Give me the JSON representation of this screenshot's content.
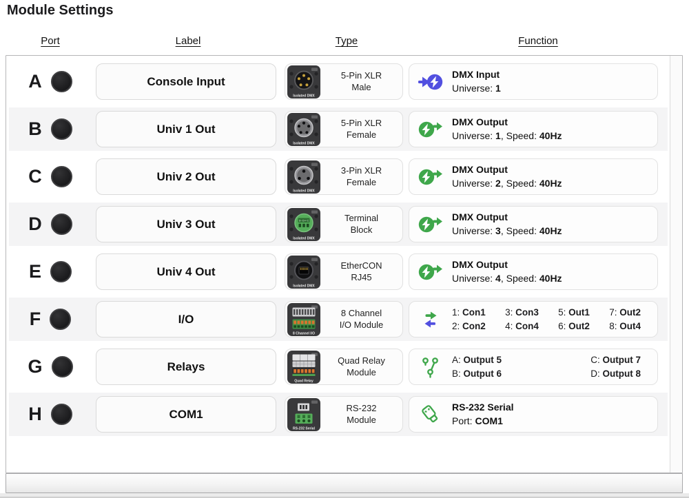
{
  "title": "Module Settings",
  "columns": [
    "Port",
    "Label",
    "Type",
    "Function"
  ],
  "colors": {
    "accent_green": "#3fa74b",
    "accent_indigo": "#5250e0",
    "stripe": "#f4f4f5"
  },
  "rows": [
    {
      "port": "A",
      "label": "Console Input",
      "type": {
        "image": "xlr-5-male",
        "caption": "Isolated DMX",
        "line1": "5-Pin XLR",
        "line2": "Male"
      },
      "function": {
        "icon": "dmx-input",
        "layout": "title-sub",
        "title": [
          {
            "t": "DMX Input",
            "b": true
          }
        ],
        "sub": [
          {
            "t": "Universe: "
          },
          {
            "t": "1",
            "b": true
          }
        ]
      }
    },
    {
      "port": "B",
      "label": "Univ 1 Out",
      "type": {
        "image": "xlr-5-female",
        "caption": "Isolated DMX",
        "line1": "5-Pin XLR",
        "line2": "Female"
      },
      "function": {
        "icon": "dmx-output",
        "layout": "title-sub",
        "title": [
          {
            "t": "DMX Output",
            "b": true
          }
        ],
        "sub": [
          {
            "t": "Universe: "
          },
          {
            "t": "1",
            "b": true
          },
          {
            "t": ", Speed: "
          },
          {
            "t": "40Hz",
            "b": true
          }
        ]
      }
    },
    {
      "port": "C",
      "label": "Univ 2 Out",
      "type": {
        "image": "xlr-3-female",
        "caption": "Isolated DMX",
        "line1": "3-Pin XLR",
        "line2": "Female"
      },
      "function": {
        "icon": "dmx-output",
        "layout": "title-sub",
        "title": [
          {
            "t": "DMX Output",
            "b": true
          }
        ],
        "sub": [
          {
            "t": "Universe: "
          },
          {
            "t": "2",
            "b": true
          },
          {
            "t": ", Speed: "
          },
          {
            "t": "40Hz",
            "b": true
          }
        ]
      }
    },
    {
      "port": "D",
      "label": "Univ 3 Out",
      "type": {
        "image": "terminal-block",
        "caption": "Isolated DMX",
        "line1": "Terminal",
        "line2": "Block"
      },
      "function": {
        "icon": "dmx-output",
        "layout": "title-sub",
        "title": [
          {
            "t": "DMX Output",
            "b": true
          }
        ],
        "sub": [
          {
            "t": "Universe: "
          },
          {
            "t": "3",
            "b": true
          },
          {
            "t": ", Speed: "
          },
          {
            "t": "40Hz",
            "b": true
          }
        ]
      }
    },
    {
      "port": "E",
      "label": "Univ 4 Out",
      "type": {
        "image": "ethercon",
        "caption": "Isolated DMX",
        "line1": "EtherCON",
        "line2": "RJ45"
      },
      "function": {
        "icon": "dmx-output",
        "layout": "title-sub",
        "title": [
          {
            "t": "DMX Output",
            "b": true
          }
        ],
        "sub": [
          {
            "t": "Universe: "
          },
          {
            "t": "4",
            "b": true
          },
          {
            "t": ", Speed: "
          },
          {
            "t": "40Hz",
            "b": true
          }
        ]
      }
    },
    {
      "port": "F",
      "label": "I/O",
      "type": {
        "image": "io-module",
        "caption": "8 Channel I/O",
        "line1": "8 Channel",
        "line2": "I/O Module"
      },
      "function": {
        "icon": "io-arrows",
        "layout": "pairs",
        "cols": [
          [
            [
              "1:",
              "Con1"
            ],
            [
              "2:",
              "Con2"
            ]
          ],
          [
            [
              "3:",
              "Con3"
            ],
            [
              "4:",
              "Con4"
            ]
          ],
          [
            [
              "5:",
              "Out1"
            ],
            [
              "6:",
              "Out2"
            ]
          ],
          [
            [
              "7:",
              "Out2"
            ],
            [
              "8:",
              "Out4"
            ]
          ]
        ]
      }
    },
    {
      "port": "G",
      "label": "Relays",
      "type": {
        "image": "relay-module",
        "caption": "Quad Relay",
        "line1": "Quad Relay",
        "line2": "Module"
      },
      "function": {
        "icon": "relay-switch",
        "layout": "pairs",
        "cols": [
          [
            [
              "A:",
              "Output 5"
            ],
            [
              "B:",
              "Output 6"
            ]
          ],
          [
            [
              "C:",
              "Output 7"
            ],
            [
              "D:",
              "Output 8"
            ]
          ]
        ]
      }
    },
    {
      "port": "H",
      "label": "COM1",
      "type": {
        "image": "rs232-module",
        "caption": "RS-232 Serial",
        "line1": "RS-232",
        "line2": "Module"
      },
      "function": {
        "icon": "serial-connector",
        "layout": "title-sub",
        "title": [
          {
            "t": "RS-232 Serial",
            "b": true
          }
        ],
        "sub": [
          {
            "t": "Port: "
          },
          {
            "t": "COM1",
            "b": true
          }
        ]
      }
    }
  ]
}
